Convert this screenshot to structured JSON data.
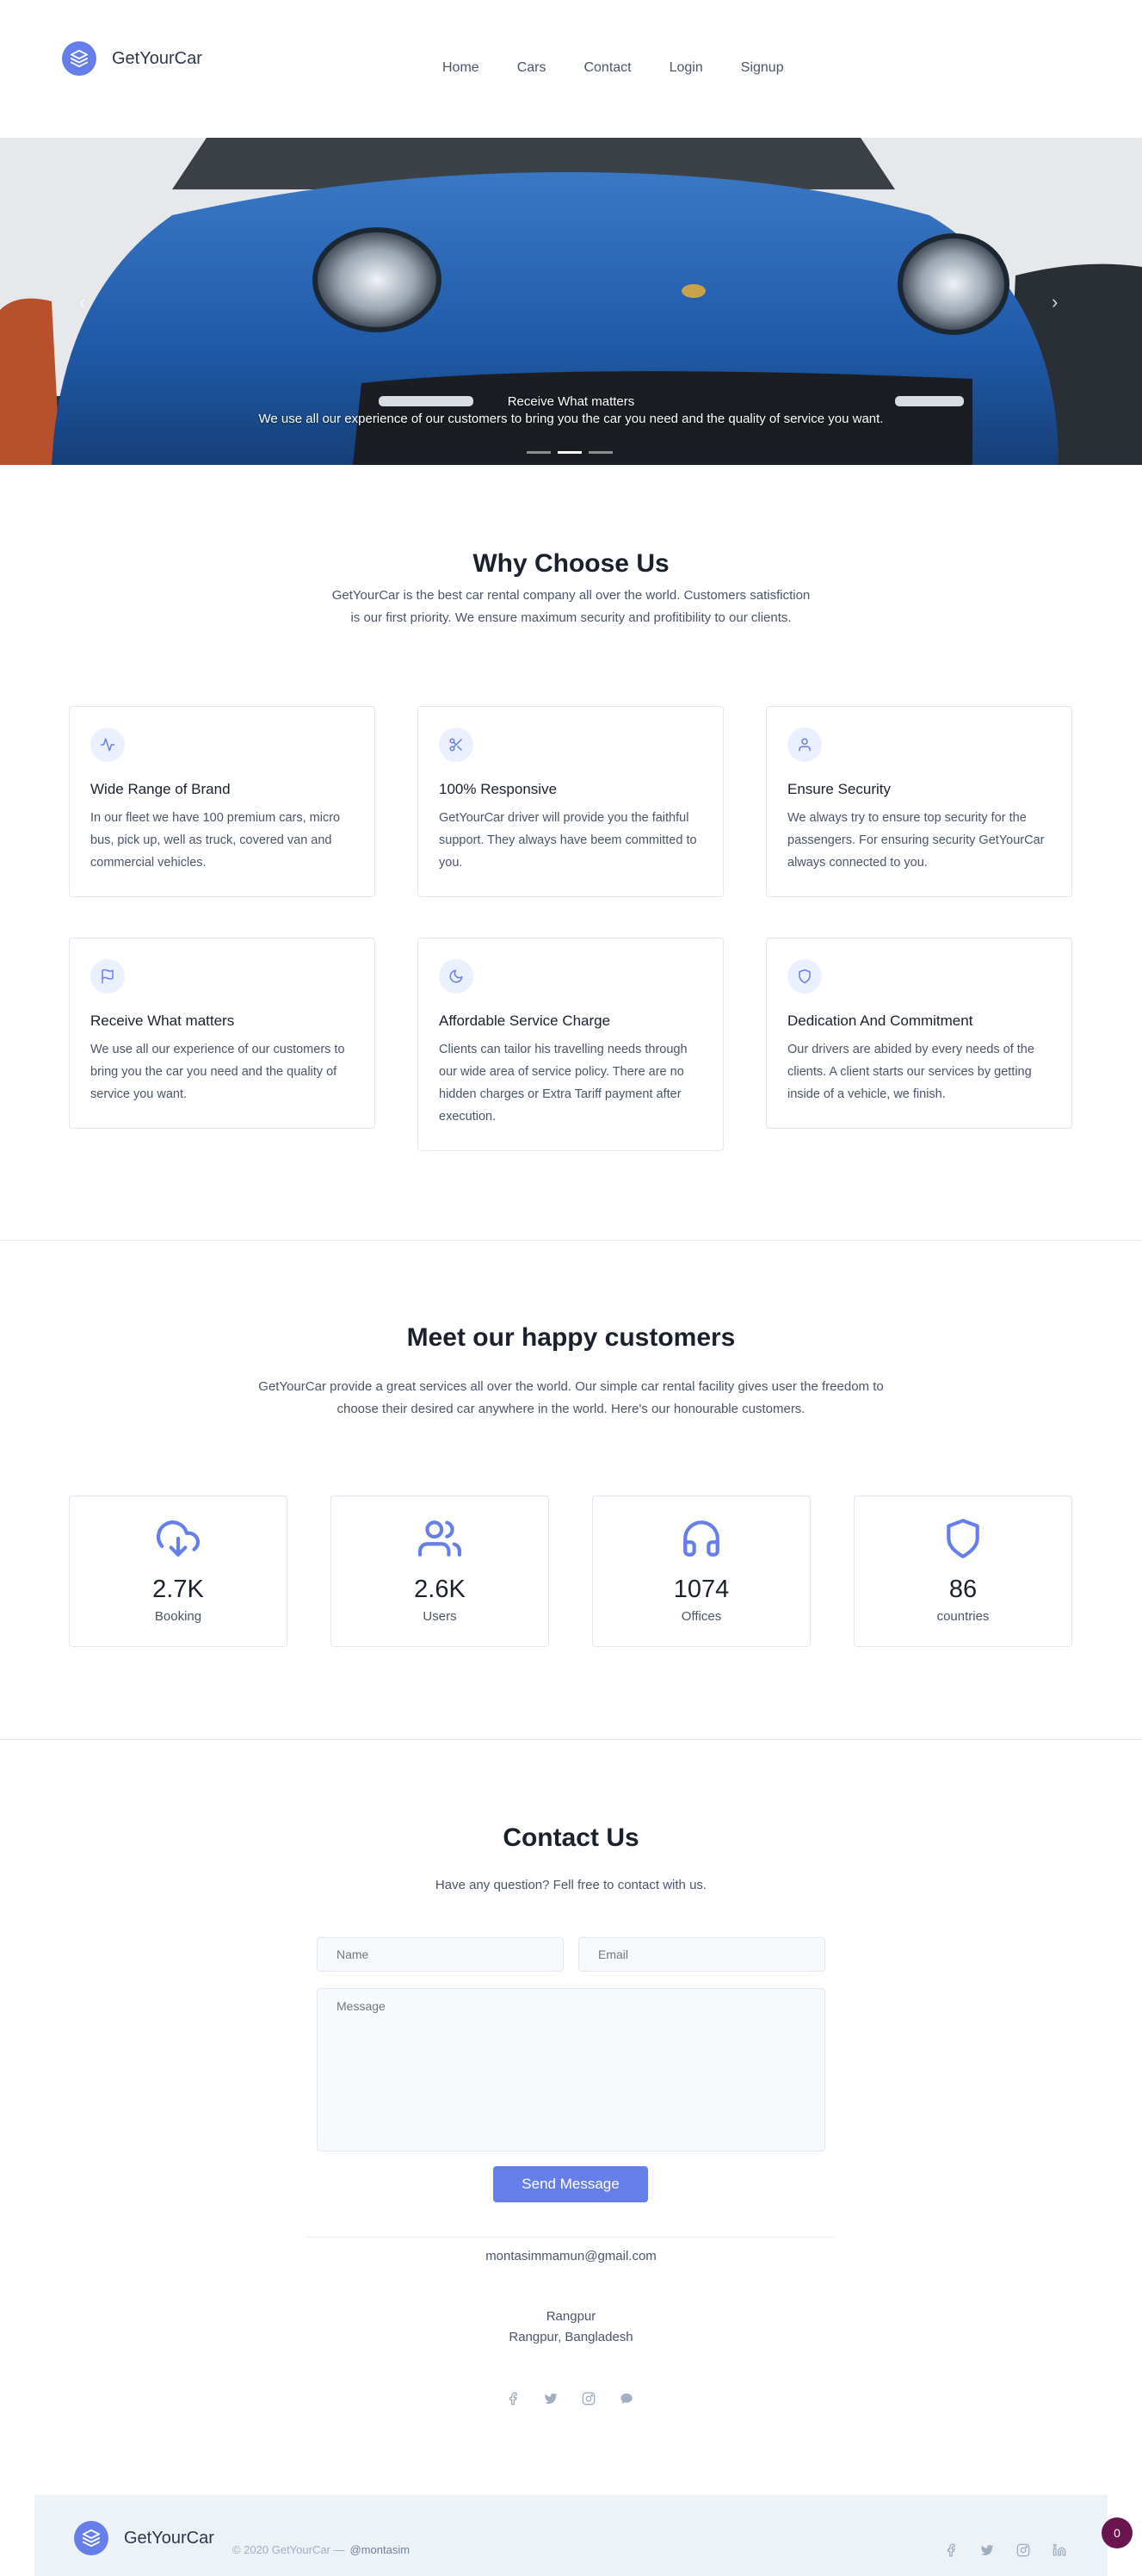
{
  "brand": {
    "name": "GetYourCar"
  },
  "nav": {
    "items": [
      "Home",
      "Cars",
      "Contact",
      "Login",
      "Signup"
    ]
  },
  "hero": {
    "title": "Receive What matters",
    "text": "We use all our experience of our customers to bring you the car you need and the quality of service you want.",
    "active_slide": 2,
    "slide_count": 3
  },
  "why": {
    "title": "Why Choose Us",
    "subtitle_line1": "GetYourCar is the best car rental company all over the world. Customers satisfiction",
    "subtitle_line2": "is our first priority. We ensure maximum security and profitibility to our clients.",
    "features": [
      {
        "icon": "activity-icon",
        "title": "Wide Range of Brand",
        "text": "In our fleet we have 100 premium cars, micro bus, pick up, well as truck, covered van and commercial vehicles."
      },
      {
        "icon": "scissors-icon",
        "title": "100% Responsive",
        "text": "GetYourCar driver will provide you the faithful support. They always have beem committed to you."
      },
      {
        "icon": "user-icon",
        "title": "Ensure Security",
        "text": "We always try to ensure top security for the passengers. For ensuring security GetYourCar always connected to you."
      },
      {
        "icon": "flag-icon",
        "title": "Receive What matters",
        "text": "We use all our experience of our customers to bring you the car you need and the quality of service you want."
      },
      {
        "icon": "moon-icon",
        "title": "Affordable Service Charge",
        "text": "Clients can tailor his travelling needs through our wide area of service policy. There are no hidden charges or Extra Tariff payment after execution."
      },
      {
        "icon": "shield-icon",
        "title": "Dedication And Commitment",
        "text": "Our drivers are abided by every needs of the clients. A client starts our services by getting inside of a vehicle, we finish."
      }
    ]
  },
  "customers": {
    "title": "Meet our happy customers",
    "subtitle_line1": "GetYourCar provide a great services all over the world. Our simple car rental facility gives user the freedom to",
    "subtitle_line2": "choose their desired car anywhere in the world. Here's our honourable customers.",
    "stats": [
      {
        "icon": "download-cloud-icon",
        "value": "2.7K",
        "label": "Booking"
      },
      {
        "icon": "users-icon",
        "value": "2.6K",
        "label": "Users"
      },
      {
        "icon": "headphones-icon",
        "value": "1074",
        "label": "Offices"
      },
      {
        "icon": "shield-icon",
        "value": "86",
        "label": "countries"
      }
    ]
  },
  "contact": {
    "title": "Contact Us",
    "subtitle": "Have any question? Fell free to contact with us.",
    "name_placeholder": "Name",
    "email_placeholder": "Email",
    "message_placeholder": "Message",
    "send_label": "Send Message",
    "email": "montasimmamun@gmail.com",
    "city": "Rangpur",
    "address": "Rangpur, Bangladesh",
    "social": [
      "facebook-icon",
      "twitter-icon",
      "instagram-icon",
      "chat-icon"
    ]
  },
  "footer": {
    "brand": "GetYourCar",
    "copyright": "© 2020 GetYourCar —",
    "handle": "@montasim",
    "social": [
      "facebook-icon",
      "twitter-icon",
      "instagram-icon",
      "linkedin-icon"
    ],
    "badge": "0"
  },
  "colors": {
    "accent": "#667eea",
    "icon_bg": "#ebf0fe",
    "footer_bg": "#edf2f7"
  }
}
